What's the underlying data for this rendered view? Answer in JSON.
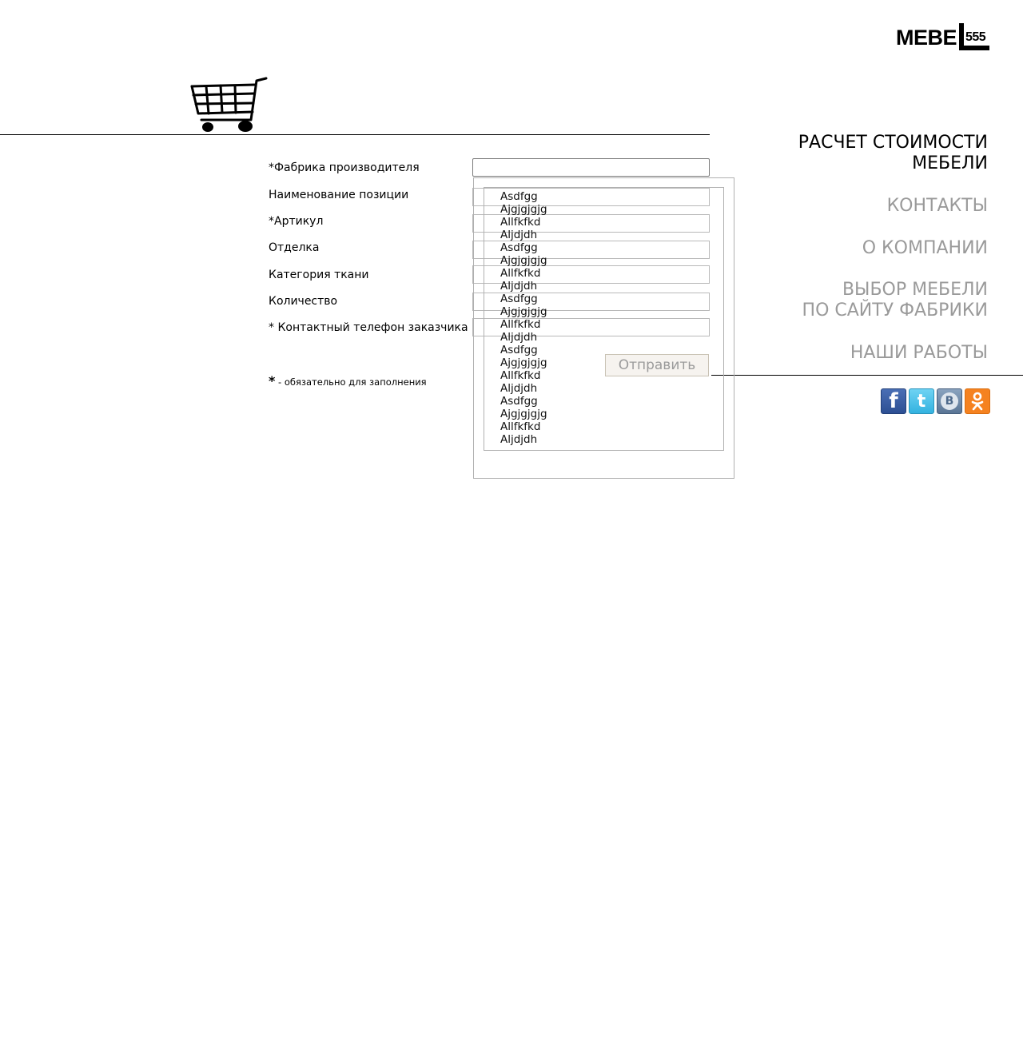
{
  "logo": {
    "text": "MEBE",
    "number": "555"
  },
  "nav": {
    "items": [
      {
        "lines": [
          "РАСЧЕТ СТОИМОСТИ",
          "МЕБЕЛИ"
        ],
        "active": true
      },
      {
        "lines": [
          "КОНТАКТЫ"
        ],
        "active": false
      },
      {
        "lines": [
          "О КОМПАНИИ"
        ],
        "active": false
      },
      {
        "lines": [
          "ВЫБОР МЕБЕЛИ",
          "ПО САЙТУ ФАБРИКИ"
        ],
        "active": false
      },
      {
        "lines": [
          "НАШИ РАБОТЫ"
        ],
        "active": false
      }
    ]
  },
  "social": {
    "facebook": {
      "icon": "facebook-icon",
      "glyph": "f"
    },
    "twitter": {
      "icon": "twitter-icon",
      "glyph": "t"
    },
    "vk": {
      "icon": "vkontakte-icon",
      "glyph": "B"
    },
    "odnoklassniki": {
      "icon": "odnoklassniki-icon",
      "glyph": "ОК"
    }
  },
  "form": {
    "fields": [
      {
        "label": "*Фабрика производителя",
        "value": ""
      },
      {
        "label": "Наименование позиции",
        "value": ""
      },
      {
        "label": "*Артикул",
        "value": ""
      },
      {
        "label": "Отделка",
        "value": ""
      },
      {
        "label": "Категория ткани",
        "value": ""
      },
      {
        "label": "Количество",
        "value": ""
      },
      {
        "label": "* Контактный телефон заказчика",
        "value": ""
      }
    ],
    "dropdown_options": [
      "Asdfgg",
      "Ajgjgjgjg",
      "Allfkfkd",
      "Aljdjdh",
      "Asdfgg",
      "Ajgjgjgjg",
      "Allfkfkd",
      "Aljdjdh",
      "Asdfgg",
      "Ajgjgjgjg",
      "Allfkfkd",
      "Aljdjdh",
      "Asdfgg",
      "Ajgjgjgjg",
      "Allfkfkd",
      "Aljdjdh",
      "Asdfgg",
      "Ajgjgjgjg",
      "Allfkfkd",
      "Aljdjdh"
    ],
    "submit_label": "Отправить",
    "required_star": "*",
    "required_note": " -  обязательно для заполнения"
  },
  "colors": {
    "nav_active": "#000000",
    "nav_inactive": "#9a9a9a",
    "submit_text": "#9b9b9b",
    "submit_bg": "#f6f3ef",
    "odnoklassniki": "#f58220"
  }
}
